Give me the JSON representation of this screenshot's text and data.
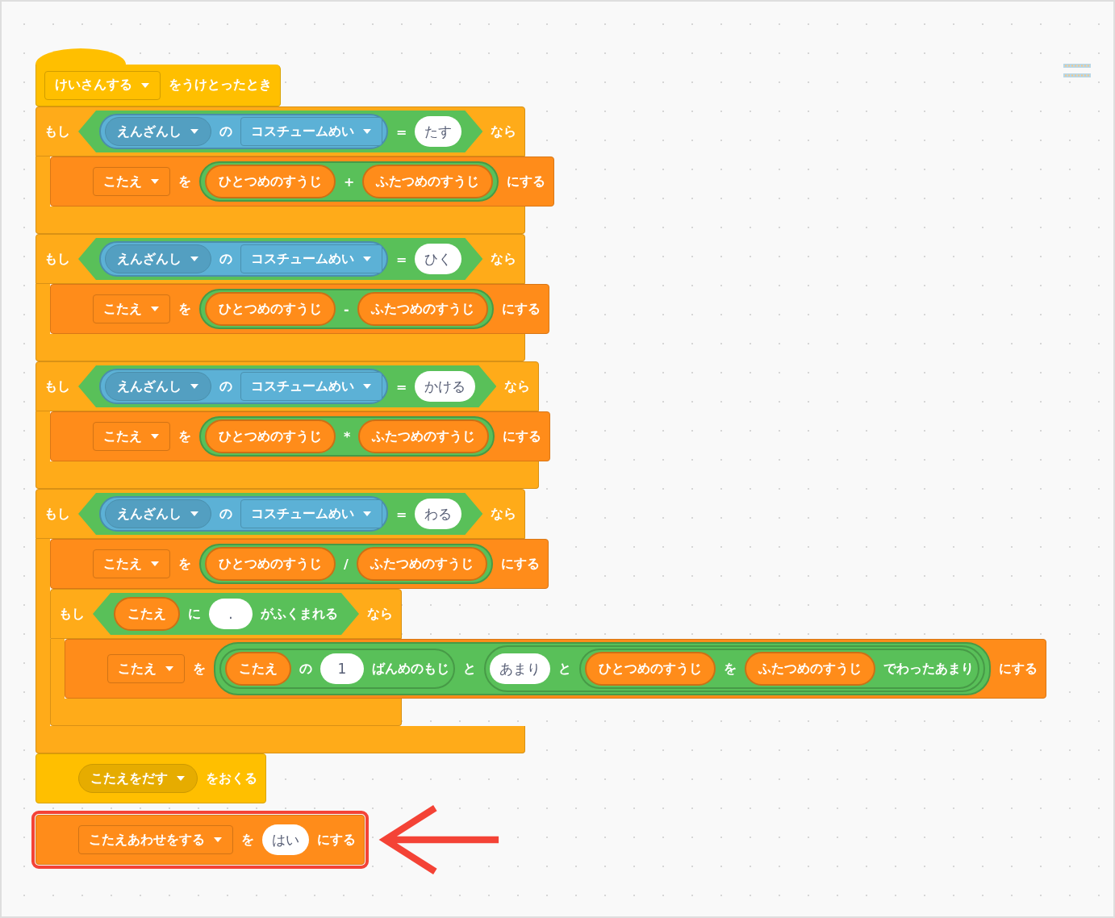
{
  "script": {
    "hat": {
      "color": "#ffbf00",
      "parts": [
        {
          "kind": "dropdown",
          "text": "けいさんする"
        },
        {
          "kind": "label",
          "text": "をうけとったとき"
        }
      ]
    },
    "blocks": [
      {
        "kind": "if",
        "color": "#ffab19",
        "highlighted": false,
        "head": [
          {
            "kind": "label",
            "text": "もし"
          },
          {
            "kind": "boolean",
            "color": "#59c059",
            "parts": [
              {
                "kind": "reporter",
                "color": "#5cb1d6",
                "parts": [
                  {
                    "kind": "menu",
                    "text": "えんざんし"
                  },
                  {
                    "kind": "label",
                    "text": "の"
                  },
                  {
                    "kind": "dropdown",
                    "text": "コスチュームめい"
                  }
                ]
              },
              {
                "kind": "label",
                "text": "="
              },
              {
                "kind": "value",
                "text": "たす"
              }
            ]
          },
          {
            "kind": "label",
            "text": "なら"
          }
        ],
        "body": [
          {
            "kind": "command",
            "color": "#ff8c1a",
            "parts": [
              {
                "kind": "dropdown",
                "text": "こたえ"
              },
              {
                "kind": "label",
                "text": "を"
              },
              {
                "kind": "reporter",
                "color": "#59c059",
                "parts": [
                  {
                    "kind": "reporter",
                    "color": "#ff8c1a",
                    "parts": [
                      {
                        "kind": "label",
                        "text": "ひとつめのすうじ"
                      }
                    ]
                  },
                  {
                    "kind": "label",
                    "text": "+"
                  },
                  {
                    "kind": "reporter",
                    "color": "#ff8c1a",
                    "parts": [
                      {
                        "kind": "label",
                        "text": "ふたつめのすうじ"
                      }
                    ]
                  }
                ]
              },
              {
                "kind": "label",
                "text": "にする"
              }
            ]
          }
        ]
      },
      {
        "kind": "if",
        "color": "#ffab19",
        "highlighted": false,
        "head": [
          {
            "kind": "label",
            "text": "もし"
          },
          {
            "kind": "boolean",
            "color": "#59c059",
            "parts": [
              {
                "kind": "reporter",
                "color": "#5cb1d6",
                "parts": [
                  {
                    "kind": "menu",
                    "text": "えんざんし"
                  },
                  {
                    "kind": "label",
                    "text": "の"
                  },
                  {
                    "kind": "dropdown",
                    "text": "コスチュームめい"
                  }
                ]
              },
              {
                "kind": "label",
                "text": "="
              },
              {
                "kind": "value",
                "text": "ひく"
              }
            ]
          },
          {
            "kind": "label",
            "text": "なら"
          }
        ],
        "body": [
          {
            "kind": "command",
            "color": "#ff8c1a",
            "parts": [
              {
                "kind": "dropdown",
                "text": "こたえ"
              },
              {
                "kind": "label",
                "text": "を"
              },
              {
                "kind": "reporter",
                "color": "#59c059",
                "parts": [
                  {
                    "kind": "reporter",
                    "color": "#ff8c1a",
                    "parts": [
                      {
                        "kind": "label",
                        "text": "ひとつめのすうじ"
                      }
                    ]
                  },
                  {
                    "kind": "label",
                    "text": "-"
                  },
                  {
                    "kind": "reporter",
                    "color": "#ff8c1a",
                    "parts": [
                      {
                        "kind": "label",
                        "text": "ふたつめのすうじ"
                      }
                    ]
                  }
                ]
              },
              {
                "kind": "label",
                "text": "にする"
              }
            ]
          }
        ]
      },
      {
        "kind": "if",
        "color": "#ffab19",
        "highlighted": false,
        "head": [
          {
            "kind": "label",
            "text": "もし"
          },
          {
            "kind": "boolean",
            "color": "#59c059",
            "parts": [
              {
                "kind": "reporter",
                "color": "#5cb1d6",
                "parts": [
                  {
                    "kind": "menu",
                    "text": "えんざんし"
                  },
                  {
                    "kind": "label",
                    "text": "の"
                  },
                  {
                    "kind": "dropdown",
                    "text": "コスチュームめい"
                  }
                ]
              },
              {
                "kind": "label",
                "text": "="
              },
              {
                "kind": "value",
                "text": "かける"
              }
            ]
          },
          {
            "kind": "label",
            "text": "なら"
          }
        ],
        "body": [
          {
            "kind": "command",
            "color": "#ff8c1a",
            "parts": [
              {
                "kind": "dropdown",
                "text": "こたえ"
              },
              {
                "kind": "label",
                "text": "を"
              },
              {
                "kind": "reporter",
                "color": "#59c059",
                "parts": [
                  {
                    "kind": "reporter",
                    "color": "#ff8c1a",
                    "parts": [
                      {
                        "kind": "label",
                        "text": "ひとつめのすうじ"
                      }
                    ]
                  },
                  {
                    "kind": "label",
                    "text": "*"
                  },
                  {
                    "kind": "reporter",
                    "color": "#ff8c1a",
                    "parts": [
                      {
                        "kind": "label",
                        "text": "ふたつめのすうじ"
                      }
                    ]
                  }
                ]
              },
              {
                "kind": "label",
                "text": "にする"
              }
            ]
          }
        ]
      },
      {
        "kind": "if",
        "color": "#ffab19",
        "highlighted": false,
        "head": [
          {
            "kind": "label",
            "text": "もし"
          },
          {
            "kind": "boolean",
            "color": "#59c059",
            "parts": [
              {
                "kind": "reporter",
                "color": "#5cb1d6",
                "parts": [
                  {
                    "kind": "menu",
                    "text": "えんざんし"
                  },
                  {
                    "kind": "label",
                    "text": "の"
                  },
                  {
                    "kind": "dropdown",
                    "text": "コスチュームめい"
                  }
                ]
              },
              {
                "kind": "label",
                "text": "="
              },
              {
                "kind": "value",
                "text": "わる"
              }
            ]
          },
          {
            "kind": "label",
            "text": "なら"
          }
        ],
        "body": [
          {
            "kind": "command",
            "color": "#ff8c1a",
            "parts": [
              {
                "kind": "dropdown",
                "text": "こたえ"
              },
              {
                "kind": "label",
                "text": "を"
              },
              {
                "kind": "reporter",
                "color": "#59c059",
                "parts": [
                  {
                    "kind": "reporter",
                    "color": "#ff8c1a",
                    "parts": [
                      {
                        "kind": "label",
                        "text": "ひとつめのすうじ"
                      }
                    ]
                  },
                  {
                    "kind": "label",
                    "text": "/"
                  },
                  {
                    "kind": "reporter",
                    "color": "#ff8c1a",
                    "parts": [
                      {
                        "kind": "label",
                        "text": "ふたつめのすうじ"
                      }
                    ]
                  }
                ]
              },
              {
                "kind": "label",
                "text": "にする"
              }
            ]
          },
          {
            "kind": "if",
            "color": "#ffab19",
            "head": [
              {
                "kind": "label",
                "text": "もし"
              },
              {
                "kind": "boolean",
                "color": "#59c059",
                "parts": [
                  {
                    "kind": "reporter",
                    "color": "#ff8c1a",
                    "parts": [
                      {
                        "kind": "label",
                        "text": "こたえ"
                      }
                    ]
                  },
                  {
                    "kind": "label",
                    "text": "に"
                  },
                  {
                    "kind": "value",
                    "text": "."
                  },
                  {
                    "kind": "label",
                    "text": "がふくまれる"
                  }
                ]
              },
              {
                "kind": "label",
                "text": "なら"
              }
            ],
            "body": [
              {
                "kind": "command",
                "color": "#ff8c1a",
                "parts": [
                  {
                    "kind": "dropdown",
                    "text": "こたえ"
                  },
                  {
                    "kind": "label",
                    "text": "を"
                  },
                  {
                    "kind": "reporter",
                    "color": "#59c059",
                    "parts": [
                      {
                        "kind": "reporter",
                        "color": "#59c059",
                        "parts": [
                          {
                            "kind": "reporter",
                            "color": "#ff8c1a",
                            "parts": [
                              {
                                "kind": "label",
                                "text": "こたえ"
                              }
                            ]
                          },
                          {
                            "kind": "label",
                            "text": "の"
                          },
                          {
                            "kind": "value",
                            "text": "1"
                          },
                          {
                            "kind": "label",
                            "text": "ばんめのもじ"
                          }
                        ]
                      },
                      {
                        "kind": "label",
                        "text": "と"
                      },
                      {
                        "kind": "reporter",
                        "color": "#59c059",
                        "parts": [
                          {
                            "kind": "value",
                            "text": "あまり"
                          },
                          {
                            "kind": "label",
                            "text": "と"
                          },
                          {
                            "kind": "reporter",
                            "color": "#59c059",
                            "parts": [
                              {
                                "kind": "reporter",
                                "color": "#ff8c1a",
                                "parts": [
                                  {
                                    "kind": "label",
                                    "text": "ひとつめのすうじ"
                                  }
                                ]
                              },
                              {
                                "kind": "label",
                                "text": "を"
                              },
                              {
                                "kind": "reporter",
                                "color": "#ff8c1a",
                                "parts": [
                                  {
                                    "kind": "label",
                                    "text": "ふたつめのすうじ"
                                  }
                                ]
                              },
                              {
                                "kind": "label",
                                "text": "でわったあまり"
                              }
                            ]
                          }
                        ]
                      }
                    ]
                  },
                  {
                    "kind": "label",
                    "text": "にする"
                  }
                ]
              }
            ]
          }
        ]
      },
      {
        "kind": "command",
        "color": "#ffbf00",
        "highlighted": false,
        "parts": [
          {
            "kind": "menu",
            "text": "こたえをだす"
          },
          {
            "kind": "label",
            "text": "をおくる"
          }
        ]
      },
      {
        "kind": "command",
        "color": "#ff8c1a",
        "highlighted": true,
        "parts": [
          {
            "kind": "dropdown",
            "text": "こたえあわせをする"
          },
          {
            "kind": "label",
            "text": "を"
          },
          {
            "kind": "value",
            "text": "はい"
          },
          {
            "kind": "label",
            "text": "にする"
          }
        ]
      }
    ]
  }
}
